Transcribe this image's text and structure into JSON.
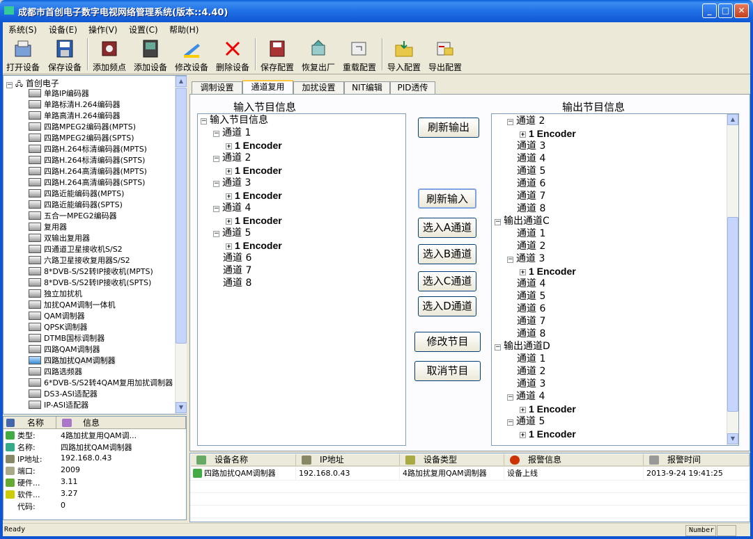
{
  "window": {
    "title": "成都市首创电子数字电视网络管理系统(版本::4.40)"
  },
  "menu": [
    "系统(S)",
    "设备(E)",
    "操作(V)",
    "设置(C)",
    "帮助(H)"
  ],
  "toolbar": [
    {
      "label": "打开设备",
      "icon": "open-device-icon"
    },
    {
      "label": "保存设备",
      "icon": "save-device-icon"
    },
    {
      "label": "添加频点",
      "icon": "add-frequency-icon"
    },
    {
      "label": "添加设备",
      "icon": "add-device-icon"
    },
    {
      "label": "修改设备",
      "icon": "edit-device-icon"
    },
    {
      "label": "删除设备",
      "icon": "delete-device-icon"
    },
    {
      "label": "保存配置",
      "icon": "save-config-icon"
    },
    {
      "label": "恢复出厂",
      "icon": "factory-reset-icon"
    },
    {
      "label": "重载配置",
      "icon": "reload-config-icon"
    },
    {
      "label": "导入配置",
      "icon": "import-config-icon"
    },
    {
      "label": "导出配置",
      "icon": "export-config-icon"
    }
  ],
  "device_tree": {
    "root": "首创电子",
    "items": [
      "单路IP编码器",
      "单路标清H.264编码器",
      "单路高清H.264编码器",
      "四路MPEG2编码器(MPTS)",
      "四路MPEG2编码器(SPTS)",
      "四路H.264标清编码器(MPTS)",
      "四路H.264标清编码器(SPTS)",
      "四路H.264高清编码器(MPTS)",
      "四路H.264高清编码器(SPTS)",
      "四路近能编码器(MPTS)",
      "四路近能编码器(SPTS)",
      "五合一MPEG2编码器",
      "复用器",
      "双输出复用器",
      "四通道卫星接收机S/S2",
      "六路卫星接收复用器S/S2",
      "8*DVB-S/S2转IP接收机(MPTS)",
      "8*DVB-S/S2转IP接收机(SPTS)",
      "独立加扰机",
      "加扰QAM调制一体机",
      "QAM调制器",
      "QPSK调制器",
      "DTMB国标调制器",
      "四路QAM调制器",
      "四路加扰QAM调制器",
      "四路选频器",
      "6*DVB-S/S2转4QAM复用加扰调制器",
      "DS3-ASI适配器",
      "IP-ASI适配器"
    ],
    "selected_index": 24
  },
  "info": {
    "headers": {
      "name": "名称",
      "info": "信息"
    },
    "rows": [
      {
        "key": "类型:",
        "value": "4路加扰复用QAM调..."
      },
      {
        "key": "名称:",
        "value": "四路加扰QAM调制器"
      },
      {
        "key": "IP地址:",
        "value": "192.168.0.43"
      },
      {
        "key": "端口:",
        "value": "2009"
      },
      {
        "key": "硬件...",
        "value": "3.11"
      },
      {
        "key": "软件...",
        "value": "3.27"
      },
      {
        "key": "代码:",
        "value": "0"
      }
    ]
  },
  "tabs": [
    "调制设置",
    "通道复用",
    "加扰设置",
    "NIT编辑",
    "PID透传"
  ],
  "active_tab": 1,
  "input_section": {
    "title": "输入节目信息",
    "nodes": [
      {
        "label": "输入节目信息",
        "exp": "−",
        "level": 0
      },
      {
        "label": "通道 1",
        "exp": "−",
        "level": 1
      },
      {
        "label": "1 Encoder",
        "exp": "+",
        "level": 2
      },
      {
        "label": "通道 2",
        "exp": "−",
        "level": 1
      },
      {
        "label": "1 Encoder",
        "exp": "+",
        "level": 2
      },
      {
        "label": "通道 3",
        "exp": "−",
        "level": 1
      },
      {
        "label": "1 Encoder",
        "exp": "+",
        "level": 2
      },
      {
        "label": "通道 4",
        "exp": "−",
        "level": 1
      },
      {
        "label": "1 Encoder",
        "exp": "+",
        "level": 2
      },
      {
        "label": "通道 5",
        "exp": "−",
        "level": 1
      },
      {
        "label": "1 Encoder",
        "exp": "+",
        "level": 2
      },
      {
        "label": "通道 6",
        "exp": "",
        "level": 1
      },
      {
        "label": "通道 7",
        "exp": "",
        "level": 1
      },
      {
        "label": "通道 8",
        "exp": "",
        "level": 1
      }
    ]
  },
  "output_section": {
    "title": "输出节目信息",
    "nodes": [
      {
        "label": "通道 2",
        "exp": "−",
        "level": 1
      },
      {
        "label": "1 Encoder",
        "exp": "+",
        "level": 2
      },
      {
        "label": "通道 3",
        "exp": "",
        "level": 1
      },
      {
        "label": "通道 4",
        "exp": "",
        "level": 1
      },
      {
        "label": "通道 5",
        "exp": "",
        "level": 1
      },
      {
        "label": "通道 6",
        "exp": "",
        "level": 1
      },
      {
        "label": "通道 7",
        "exp": "",
        "level": 1
      },
      {
        "label": "通道 8",
        "exp": "",
        "level": 1
      },
      {
        "label": "输出通道C",
        "exp": "−",
        "level": 0
      },
      {
        "label": "通道 1",
        "exp": "",
        "level": 1
      },
      {
        "label": "通道 2",
        "exp": "",
        "level": 1
      },
      {
        "label": "通道 3",
        "exp": "−",
        "level": 1
      },
      {
        "label": "1 Encoder",
        "exp": "+",
        "level": 2
      },
      {
        "label": "通道 4",
        "exp": "",
        "level": 1
      },
      {
        "label": "通道 5",
        "exp": "",
        "level": 1
      },
      {
        "label": "通道 6",
        "exp": "",
        "level": 1
      },
      {
        "label": "通道 7",
        "exp": "",
        "level": 1
      },
      {
        "label": "通道 8",
        "exp": "",
        "level": 1
      },
      {
        "label": "输出通道D",
        "exp": "−",
        "level": 0
      },
      {
        "label": "通道 1",
        "exp": "",
        "level": 1
      },
      {
        "label": "通道 2",
        "exp": "",
        "level": 1
      },
      {
        "label": "通道 3",
        "exp": "",
        "level": 1
      },
      {
        "label": "通道 4",
        "exp": "−",
        "level": 1
      },
      {
        "label": "1 Encoder",
        "exp": "+",
        "level": 2
      },
      {
        "label": "通道 5",
        "exp": "−",
        "level": 1
      },
      {
        "label": "1 Encoder",
        "exp": "+",
        "level": 2
      }
    ]
  },
  "buttons": {
    "refresh_output": "刷新输出",
    "refresh_input": "刷新输入",
    "select_a": "选入A通道",
    "select_b": "选入B通道",
    "select_c": "选入C通道",
    "select_d": "选入D通道",
    "modify": "修改节目",
    "cancel": "取消节目"
  },
  "device_list": {
    "headers": [
      "设备名称",
      "IP地址",
      "设备类型",
      "报警信息",
      "报警时间"
    ],
    "rows": [
      [
        "四路加扰QAM调制器",
        "192.168.0.43",
        "4路加扰复用QAM调制器",
        "设备上线",
        "2013-9-24 19:41:25"
      ]
    ]
  },
  "status": {
    "text": "Ready",
    "pane1": "Number",
    "pane2": ""
  }
}
